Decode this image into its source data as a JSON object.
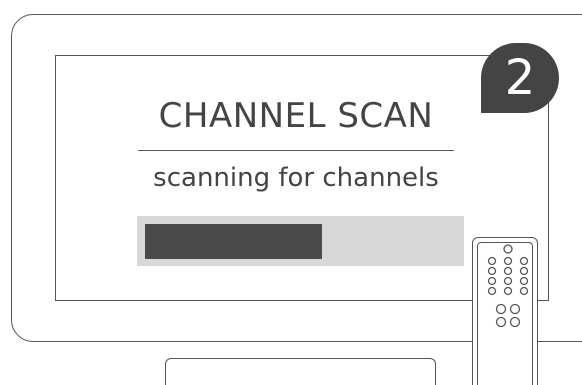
{
  "screen": {
    "title": "CHANNEL SCAN",
    "subtitle": "scanning for channels"
  },
  "progress": {
    "fraction": 0.57
  },
  "step_badge": {
    "number": "2"
  },
  "icons": {
    "remote": "remote-control-icon"
  },
  "colors": {
    "text": "#444444",
    "progress_track": "#d8d8d8",
    "progress_fill": "#4a4a4a",
    "badge": "#444444",
    "outline": "#555555"
  }
}
